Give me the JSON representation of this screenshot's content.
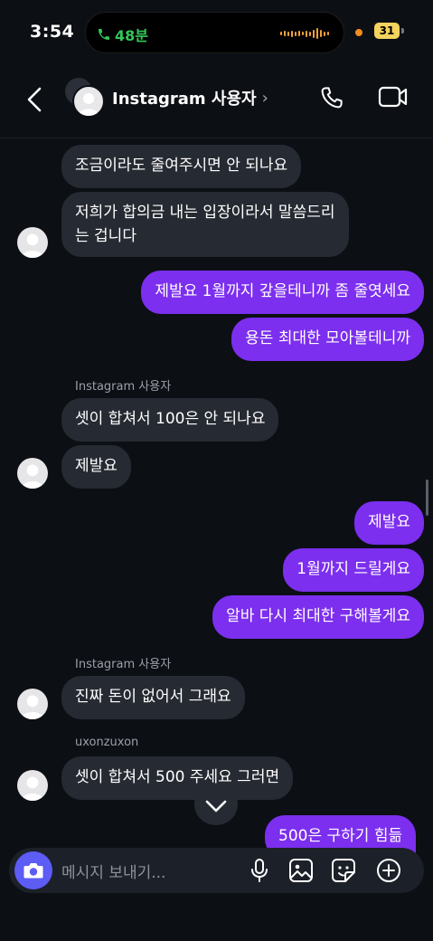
{
  "status_bar": {
    "time": "3:54",
    "call_duration": "48분",
    "battery": "31"
  },
  "header": {
    "title": "Instagram 사용자",
    "chevron": "›"
  },
  "messages": {
    "m1": "조금이라도 줄여주시면 안 되나요",
    "m2a": "저희가 합의금 내는 입장이라서 말씀드리",
    "m2b": "는 겁니다",
    "m3": "제발요 1월까지 갚을테니까 좀 줄엿세요",
    "m4": "용돈 최대한 모아볼테니까",
    "sender1": "Instagram 사용자",
    "m5": "셋이 합쳐서 100은 안 되나요",
    "m6": "제발요",
    "m7": "제발요",
    "m8": "1월까지 드릴게요",
    "m9": "알바 다시 최대한 구해볼게요",
    "sender2": "Instagram 사용자",
    "m10": "진짜 돈이 없어서 그래요",
    "sender3": "uxonzuxon",
    "m11": "셋이 합쳐서 500 주세요 그러면",
    "m12": "500은 구하기 힘듦"
  },
  "composer": {
    "placeholder": "메시지 보내기..."
  },
  "colors": {
    "background": "#0c0f14",
    "incoming_bubble": "#262a32",
    "outgoing_bubble": "#7c2fee",
    "camera_button": "#5d5cf5",
    "call_green": "#34c759"
  },
  "icons": [
    "back-icon",
    "phone-icon",
    "video-icon",
    "camera-icon",
    "microphone-icon",
    "gallery-icon",
    "sticker-icon",
    "plus-icon",
    "chevron-down-icon"
  ]
}
